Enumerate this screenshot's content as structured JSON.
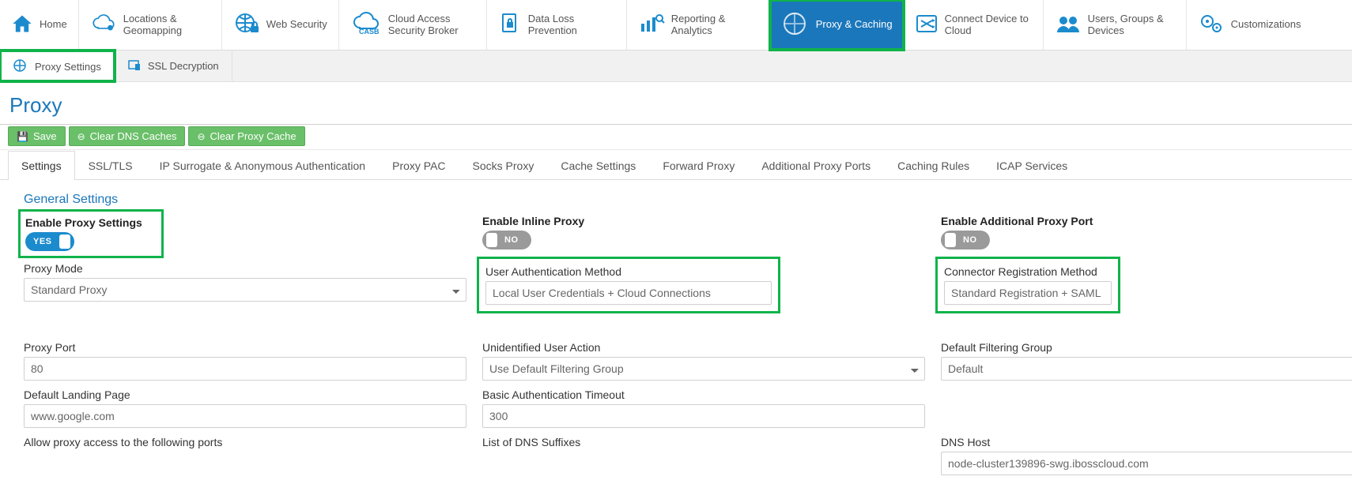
{
  "topnav": {
    "items": [
      {
        "label": "Home"
      },
      {
        "label": "Locations & Geomapping"
      },
      {
        "label": "Web Security"
      },
      {
        "label": "Cloud Access Security Broker"
      },
      {
        "label": "Data Loss Prevention"
      },
      {
        "label": "Reporting & Analytics"
      },
      {
        "label": "Proxy & Caching"
      },
      {
        "label": "Connect Device to Cloud"
      },
      {
        "label": "Users, Groups & Devices"
      },
      {
        "label": "Customizations"
      }
    ]
  },
  "subnav": {
    "items": [
      {
        "label": "Proxy Settings"
      },
      {
        "label": "SSL Decryption"
      }
    ]
  },
  "page_title": "Proxy",
  "actions": {
    "save": "Save",
    "clear_dns": "Clear DNS Caches",
    "clear_proxy": "Clear Proxy Cache"
  },
  "tabs": [
    "Settings",
    "SSL/TLS",
    "IP Surrogate & Anonymous Authentication",
    "Proxy PAC",
    "Socks Proxy",
    "Cache Settings",
    "Forward Proxy",
    "Additional Proxy Ports",
    "Caching Rules",
    "ICAP Services"
  ],
  "section_title": "General Settings",
  "toggles": {
    "enable_proxy": {
      "label": "Enable Proxy Settings",
      "state": "on",
      "text": "YES"
    },
    "inline_proxy": {
      "label": "Enable Inline Proxy",
      "state": "off",
      "text": "NO"
    },
    "additional": {
      "label": "Enable Additional Proxy Port",
      "state": "off",
      "text": "NO"
    }
  },
  "fields": {
    "proxy_mode": {
      "label": "Proxy Mode",
      "value": "Standard Proxy"
    },
    "user_auth": {
      "label": "User Authentication Method",
      "value": "Local User Credentials + Cloud Connections"
    },
    "connector_reg": {
      "label": "Connector Registration Method",
      "value": "Standard Registration + SAML"
    },
    "proxy_port": {
      "label": "Proxy Port",
      "value": "80"
    },
    "unid_action": {
      "label": "Unidentified User Action",
      "value": "Use Default Filtering Group"
    },
    "default_group": {
      "label": "Default Filtering Group",
      "value": "Default"
    },
    "landing": {
      "label": "Default Landing Page",
      "value": "www.google.com"
    },
    "basic_auth_to": {
      "label": "Basic Authentication Timeout",
      "value": "300"
    },
    "allow_ports": {
      "label": "Allow proxy access to the following ports"
    },
    "dns_suffixes": {
      "label": "List of DNS Suffixes"
    },
    "dns_host": {
      "label": "DNS Host",
      "value": "node-cluster139896-swg.ibosscloud.com"
    }
  }
}
